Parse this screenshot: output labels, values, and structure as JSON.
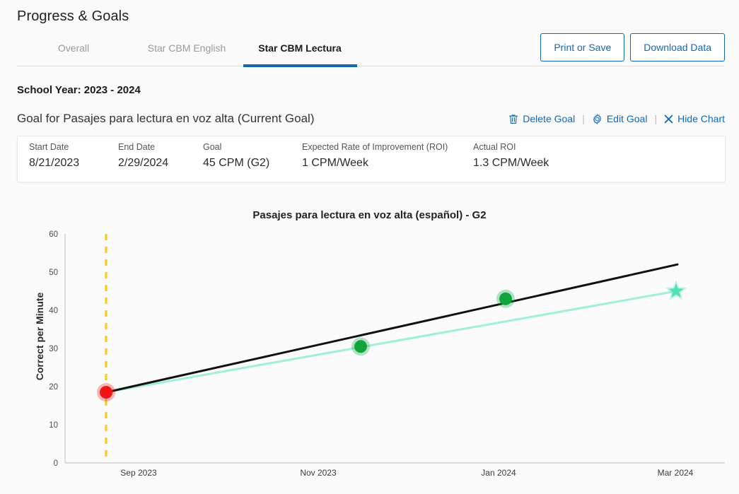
{
  "page": {
    "title": "Progress & Goals"
  },
  "tabs": [
    {
      "label": "Overall",
      "active": false
    },
    {
      "label": "Star CBM English",
      "active": false
    },
    {
      "label": "Star CBM Lectura",
      "active": true
    }
  ],
  "header_buttons": [
    {
      "label": "Print or Save"
    },
    {
      "label": "Download Data"
    }
  ],
  "school_year": "School Year: 2023 - 2024",
  "goal": {
    "title": "Goal for Pasajes para lectura en voz alta (Current Goal)",
    "actions": [
      {
        "label": "Delete Goal",
        "icon": "trash-icon"
      },
      {
        "label": "Edit Goal",
        "icon": "gear-icon"
      },
      {
        "label": "Hide Chart",
        "icon": "close-icon"
      }
    ],
    "separator": "|"
  },
  "info_table": {
    "headers": [
      "Start Date",
      "End Date",
      "Goal",
      "Expected Rate of Improvement (ROI)",
      "Actual ROI"
    ],
    "values": [
      "8/21/2023",
      "2/29/2024",
      "45 CPM (G2)",
      "1 CPM/Week",
      "1.3 CPM/Week"
    ]
  },
  "colors": {
    "accent_blue": "#1667b1",
    "goal_line": "#111111",
    "trend_line": "#9ff0d6",
    "baseline_point": "#f01414",
    "progress_point": "#11a63c",
    "star": "#4fe0b5",
    "start_marker": "#ffc807"
  },
  "chart_data": {
    "type": "line",
    "title": "Pasajes para lectura en voz alta (español) - G2",
    "xlabel": "",
    "ylabel": "Correct per Minute",
    "ylim": [
      0,
      60
    ],
    "yticks": [
      0,
      10,
      20,
      30,
      40,
      50,
      60
    ],
    "xticks": [
      "Sep 2023",
      "Nov 2023",
      "Jan 2024",
      "Mar 2024"
    ],
    "grid": false,
    "legend": "none",
    "series": [
      {
        "name": "Goal Line",
        "type": "line",
        "color": "#111111",
        "points": [
          {
            "x": "8/21/2023",
            "y": 18.5
          },
          {
            "x": "2/29/2024",
            "y": 52
          }
        ]
      },
      {
        "name": "Trend Line (Actual ROI)",
        "type": "line",
        "color": "#9ff0d6",
        "points": [
          {
            "x": "8/21/2023",
            "y": 18.5
          },
          {
            "x": "3/2024",
            "y": 45
          }
        ]
      },
      {
        "name": "Scores",
        "type": "scatter",
        "points": [
          {
            "x": "Aug 2023",
            "y": 18.5,
            "color": "#f01414",
            "marker": "circle"
          },
          {
            "x": "Nov 2023",
            "y": 30.5,
            "color": "#11a63c",
            "marker": "circle"
          },
          {
            "x": "Jan 2024",
            "y": 43,
            "color": "#11a63c",
            "marker": "circle"
          },
          {
            "x": "Mar 2024",
            "y": 45,
            "color": "#4fe0b5",
            "marker": "star"
          }
        ]
      }
    ],
    "annotations": [
      {
        "type": "vline",
        "x": "Aug 2023",
        "color": "#ffc807",
        "style": "dashed"
      }
    ]
  }
}
